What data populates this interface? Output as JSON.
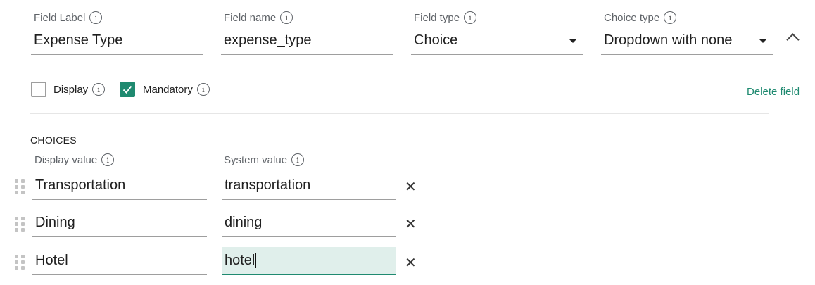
{
  "field_config": {
    "field_label": {
      "label": "Field Label",
      "value": "Expense Type"
    },
    "field_name": {
      "label": "Field name",
      "value": "expense_type"
    },
    "field_type": {
      "label": "Field type",
      "value": "Choice"
    },
    "choice_type": {
      "label": "Choice type",
      "value": "Dropdown with none"
    }
  },
  "options": {
    "display": {
      "label": "Display",
      "checked": false
    },
    "mandatory": {
      "label": "Mandatory",
      "checked": true
    },
    "delete_label": "Delete field"
  },
  "choices": {
    "section_title": "CHOICES",
    "display_header": "Display value",
    "system_header": "System value",
    "rows": [
      {
        "display": "Transportation",
        "system": "transportation"
      },
      {
        "display": "Dining",
        "system": "dining"
      },
      {
        "display": "Hotel",
        "system": "hotel"
      }
    ]
  },
  "icons": {
    "info": "i",
    "close": "✕",
    "check": "check-icon",
    "drag": "drag-handle-icon",
    "collapse": "chevron-up-icon"
  },
  "colors": {
    "accent": "#1f8a70",
    "active_field_bg": "#e0efeb"
  }
}
